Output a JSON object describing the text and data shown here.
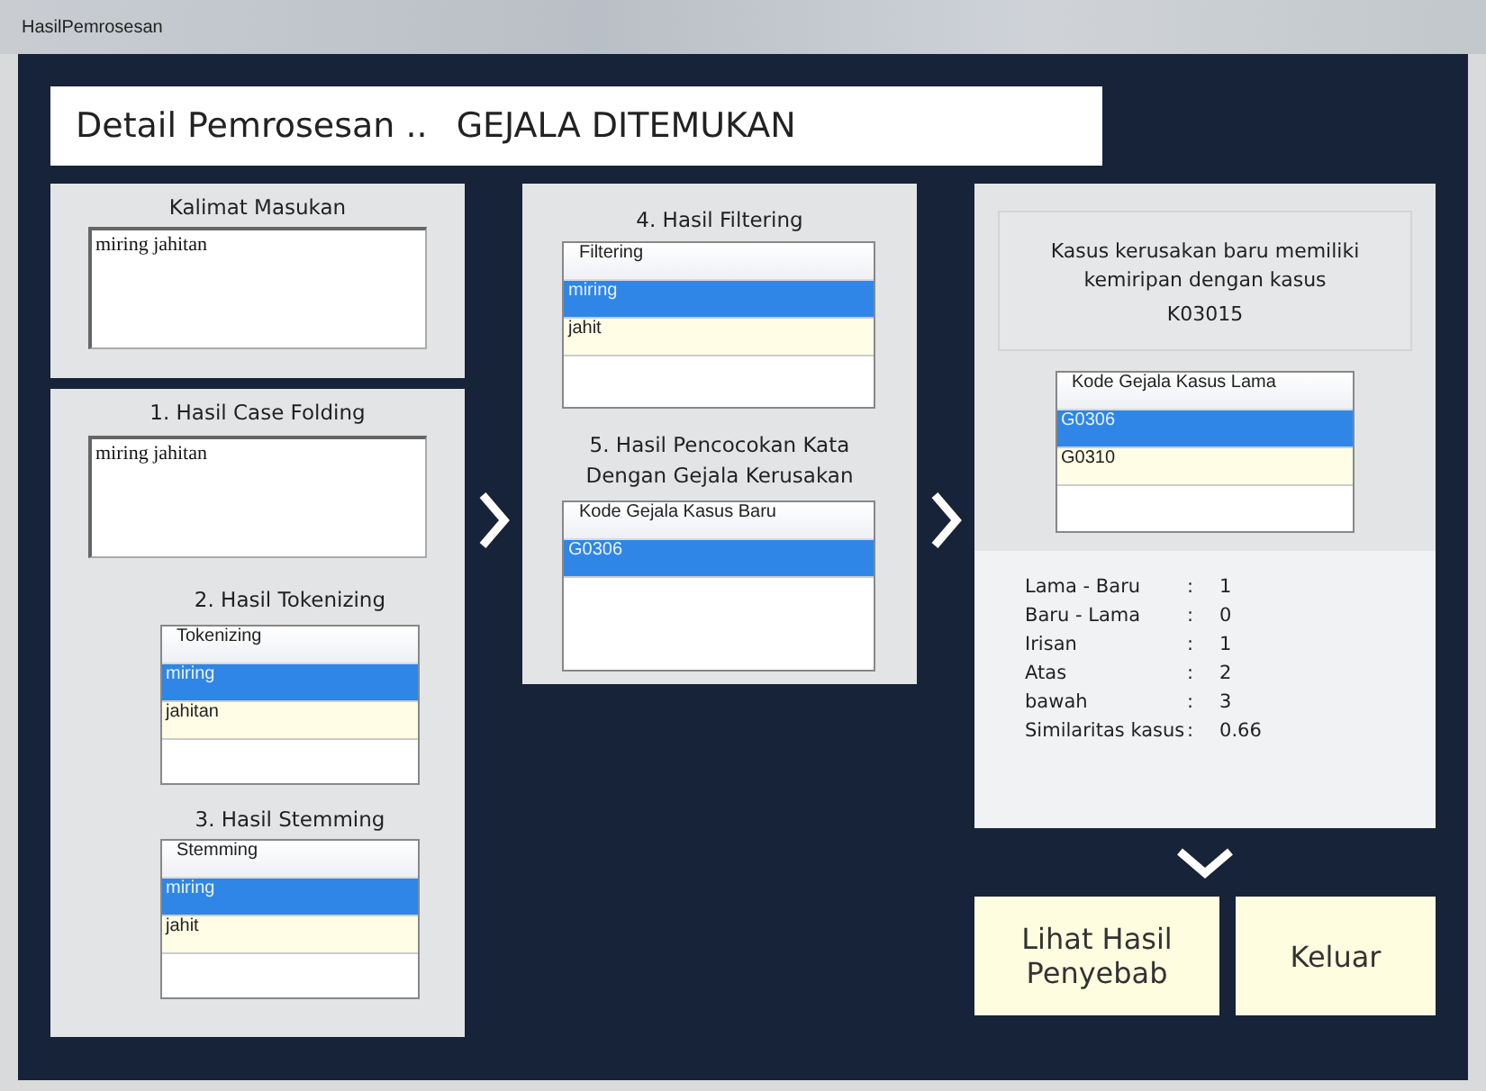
{
  "window": {
    "title": "HasilPemrosesan"
  },
  "header": {
    "title": "Detail Pemrosesan ..",
    "status": "GEJALA DITEMUKAN"
  },
  "input_panel": {
    "title": "Kalimat Masukan",
    "value": "miring jahitan"
  },
  "case_folding": {
    "title": "1. Hasil Case Folding",
    "value": "miring jahitan"
  },
  "tokenizing": {
    "title": "2. Hasil Tokenizing",
    "column": "Tokenizing",
    "rows": [
      {
        "text": "miring",
        "selected": true
      },
      {
        "text": "jahitan",
        "selected": false
      }
    ]
  },
  "stemming": {
    "title": "3. Hasil Stemming",
    "column": "Stemming",
    "rows": [
      {
        "text": "miring",
        "selected": true
      },
      {
        "text": "jahit",
        "selected": false
      }
    ]
  },
  "filtering": {
    "title": "4. Hasil Filtering",
    "column": "Filtering",
    "rows": [
      {
        "text": "miring",
        "selected": true
      },
      {
        "text": "jahit",
        "selected": false
      }
    ]
  },
  "matching": {
    "title": "5. Hasil Pencocokan Kata Dengan Gejala Kerusakan",
    "column": "Kode Gejala Kasus Baru",
    "rows": [
      {
        "text": "G0306",
        "selected": true
      }
    ]
  },
  "result": {
    "message": "Kasus kerusakan baru memiliki kemiripan dengan kasus",
    "case_code": "K03015",
    "column": "Kode Gejala Kasus Lama",
    "rows": [
      {
        "text": "G0306",
        "selected": true
      },
      {
        "text": "G0310",
        "selected": false
      }
    ]
  },
  "stats": [
    {
      "label": "Lama - Baru",
      "separator": ":",
      "value": "1"
    },
    {
      "label": "Baru - Lama",
      "separator": ":",
      "value": "0"
    },
    {
      "label": "Irisan",
      "separator": ":",
      "value": "1"
    },
    {
      "label": "Atas",
      "separator": ":",
      "value": "2"
    },
    {
      "label": "bawah",
      "separator": ":",
      "value": "3"
    },
    {
      "label": "Similaritas kasus",
      "separator": ":",
      "value": "0.66"
    }
  ],
  "buttons": [
    {
      "label": "Lihat Hasil Penyebab"
    },
    {
      "label": "Keluar"
    }
  ]
}
